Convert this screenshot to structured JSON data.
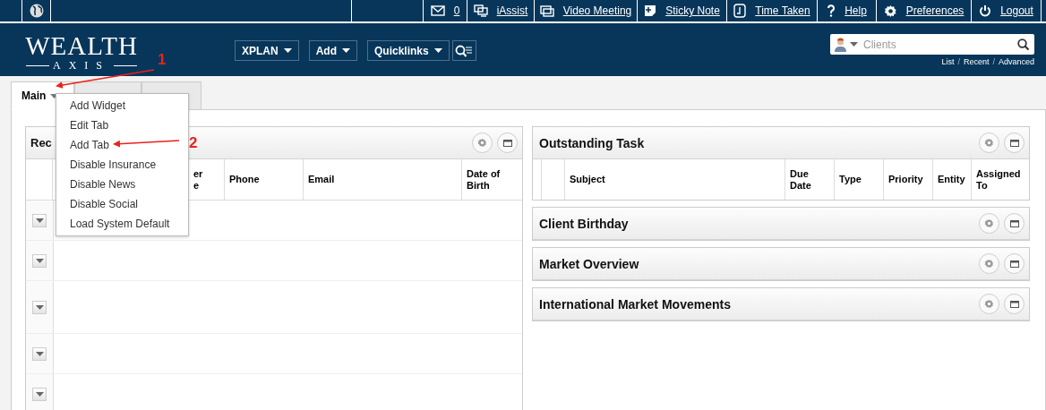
{
  "top_bar": {
    "items": [
      {
        "kind": "mail",
        "label": "0"
      },
      {
        "kind": "monitor",
        "label": "iAssist"
      },
      {
        "kind": "video",
        "label": "Video Meeting"
      },
      {
        "kind": "note",
        "label": "Sticky Note"
      },
      {
        "kind": "clock",
        "label": "Time Taken"
      },
      {
        "kind": "question",
        "label": "Help"
      },
      {
        "kind": "gear",
        "label": "Preferences"
      },
      {
        "kind": "power",
        "label": "Logout"
      }
    ]
  },
  "logo": {
    "line1": "WEALTH",
    "line2": "AXIS"
  },
  "nav": [
    "XPLAN",
    "Add",
    "Quicklinks"
  ],
  "client_search": {
    "placeholder": "Clients",
    "links": [
      "List",
      "Recent",
      "Advanced"
    ],
    "separator": "/"
  },
  "tabs": [
    {
      "label": "Main",
      "selected": true
    },
    {
      "selected": false
    },
    {
      "selected": false
    }
  ],
  "tab_menu": {
    "items": [
      "Add Widget",
      "Edit Tab",
      "Add Tab",
      "Disable Insurance",
      "Disable News",
      "Disable Social",
      "Load System Default"
    ]
  },
  "left_widget": {
    "title": "Rec",
    "columns": [
      "",
      "",
      "er\ne",
      "Phone",
      "Email",
      "Date of Birth"
    ],
    "rows": [
      {
        "kind": "blank"
      },
      {
        "kind": "blank"
      },
      {
        "kind": "tall"
      },
      {
        "kind": "blank"
      },
      {
        "kind": "blank"
      }
    ]
  },
  "right_widgets": [
    {
      "title": "Outstanding Task",
      "columns": [
        "",
        "",
        "Subject",
        "Due Date",
        "Type",
        "Priority",
        "Entity",
        "Assigned To"
      ]
    },
    {
      "title": "Client Birthday"
    },
    {
      "title": "Market Overview"
    },
    {
      "title": "International Market Movements"
    }
  ],
  "annotations": [
    {
      "label": "1"
    },
    {
      "label": "2"
    }
  ]
}
